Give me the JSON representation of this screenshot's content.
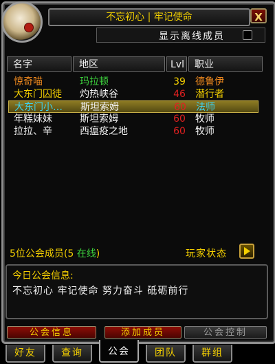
{
  "window": {
    "title": "不忘初心 | 牢记使命",
    "close_label": "X"
  },
  "toggle": {
    "label": "显示离线成员"
  },
  "columns": {
    "name": "名字",
    "zone": "地区",
    "level": "Lvl",
    "class": "职业"
  },
  "members": [
    {
      "name": "惊奇喵",
      "zone": "玛拉顿",
      "level": "39",
      "class": "德鲁伊",
      "name_color": "#f08a1e",
      "zone_color": "#3cd23c",
      "level_color": "#f5d000",
      "class_color": "#f08a1e",
      "selected": false
    },
    {
      "name": "大东门囚徒",
      "zone": "灼热峡谷",
      "level": "46",
      "class": "潜行者",
      "name_color": "#f5d000",
      "zone_color": "#f0f0f0",
      "level_color": "#e02020",
      "class_color": "#f5d000",
      "selected": false
    },
    {
      "name": "大东门小…",
      "zone": "斯坦索姆",
      "level": "60",
      "class": "法师",
      "name_color": "#3cd2f0",
      "zone_color": "#f0f0f0",
      "level_color": "#e02020",
      "class_color": "#3cd2f0",
      "selected": true
    },
    {
      "name": "年糕妹妹",
      "zone": "斯坦索姆",
      "level": "60",
      "class": "牧师",
      "name_color": "#f0f0f0",
      "zone_color": "#f0f0f0",
      "level_color": "#e02020",
      "class_color": "#f0f0f0",
      "selected": false
    },
    {
      "name": "拉拉、辛",
      "zone": "西瘟疫之地",
      "level": "60",
      "class": "牧师",
      "name_color": "#f0f0f0",
      "zone_color": "#f0f0f0",
      "level_color": "#e02020",
      "class_color": "#f0f0f0",
      "selected": false
    }
  ],
  "summary": {
    "count_text": "5位公会成员(5 ",
    "online_text": "在线",
    "close_paren": ")"
  },
  "player_status_label": "玩家状态",
  "motd": {
    "title": "今日公会信息:",
    "text": "不忘初心 牢记使命 努力奋斗 砥砺前行"
  },
  "buttons": {
    "guild_info": "公会信息",
    "add_member": "添加成员",
    "guild_control": "公会控制"
  },
  "tabs": [
    {
      "label": "好友"
    },
    {
      "label": "查询"
    },
    {
      "label": "公会"
    },
    {
      "label": "团队"
    },
    {
      "label": "群组"
    }
  ]
}
